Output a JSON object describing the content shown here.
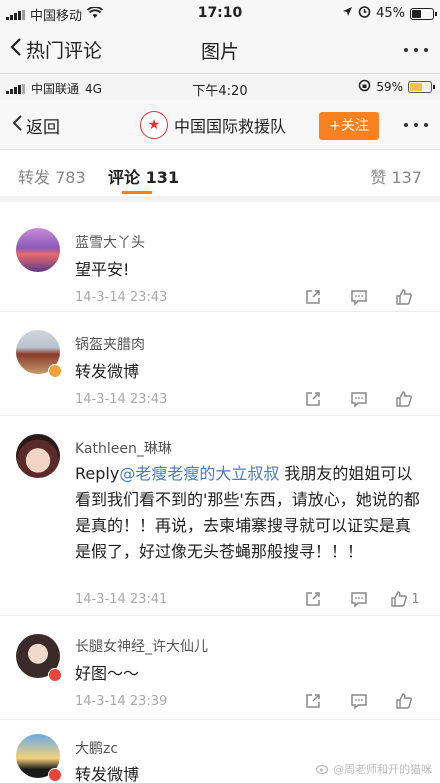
{
  "status_outer": {
    "carrier": "中国移动",
    "time": "17:10",
    "battery": "45%",
    "battery_level": 0.45
  },
  "outer_nav": {
    "back_label": "热门评论",
    "title": "图片"
  },
  "status_inner": {
    "carrier": "中国联通",
    "network": "4G",
    "time": "下午4:20",
    "battery": "59%",
    "battery_level": 0.59
  },
  "inner_nav": {
    "back_label": "返回",
    "account_name": "中国国际救援队",
    "follow_label": "+关注"
  },
  "tabs": {
    "repost": "转发 783",
    "comments": "评论 131",
    "likes": "赞 137"
  },
  "comments": [
    {
      "name": "蓝雪大丫头",
      "text": "望平安!",
      "time": "14-3-14 23:43",
      "likes": ""
    },
    {
      "name": "锅盔夹腊肉",
      "text": "转发微博",
      "time": "14-3-14 23:43",
      "likes": ""
    },
    {
      "name": "Kathleen_琳琳",
      "reply_prefix": "Reply",
      "mention": "@老瘦老瘦的大立叔叔",
      "text": " 我朋友的姐姐可以看到我们看不到的'那些'东西，请放心，她说的都是真的！！再说，去柬埔寨搜寻就可以证实是真是假了，好过像无头苍蝇那般搜寻！！！",
      "time": "14-3-14 23:41",
      "likes": "1"
    },
    {
      "name": "长腿女神经_许大仙儿",
      "text": "好图～～",
      "time": "14-3-14 23:39",
      "likes": ""
    },
    {
      "name": "大鹏zc",
      "text": "转发微博",
      "time": "",
      "likes": ""
    }
  ],
  "watermark": "@周老师和开的猫咪",
  "icons": {
    "repost": "share-icon",
    "comment": "comment-icon",
    "like": "thumbs-up-icon"
  }
}
